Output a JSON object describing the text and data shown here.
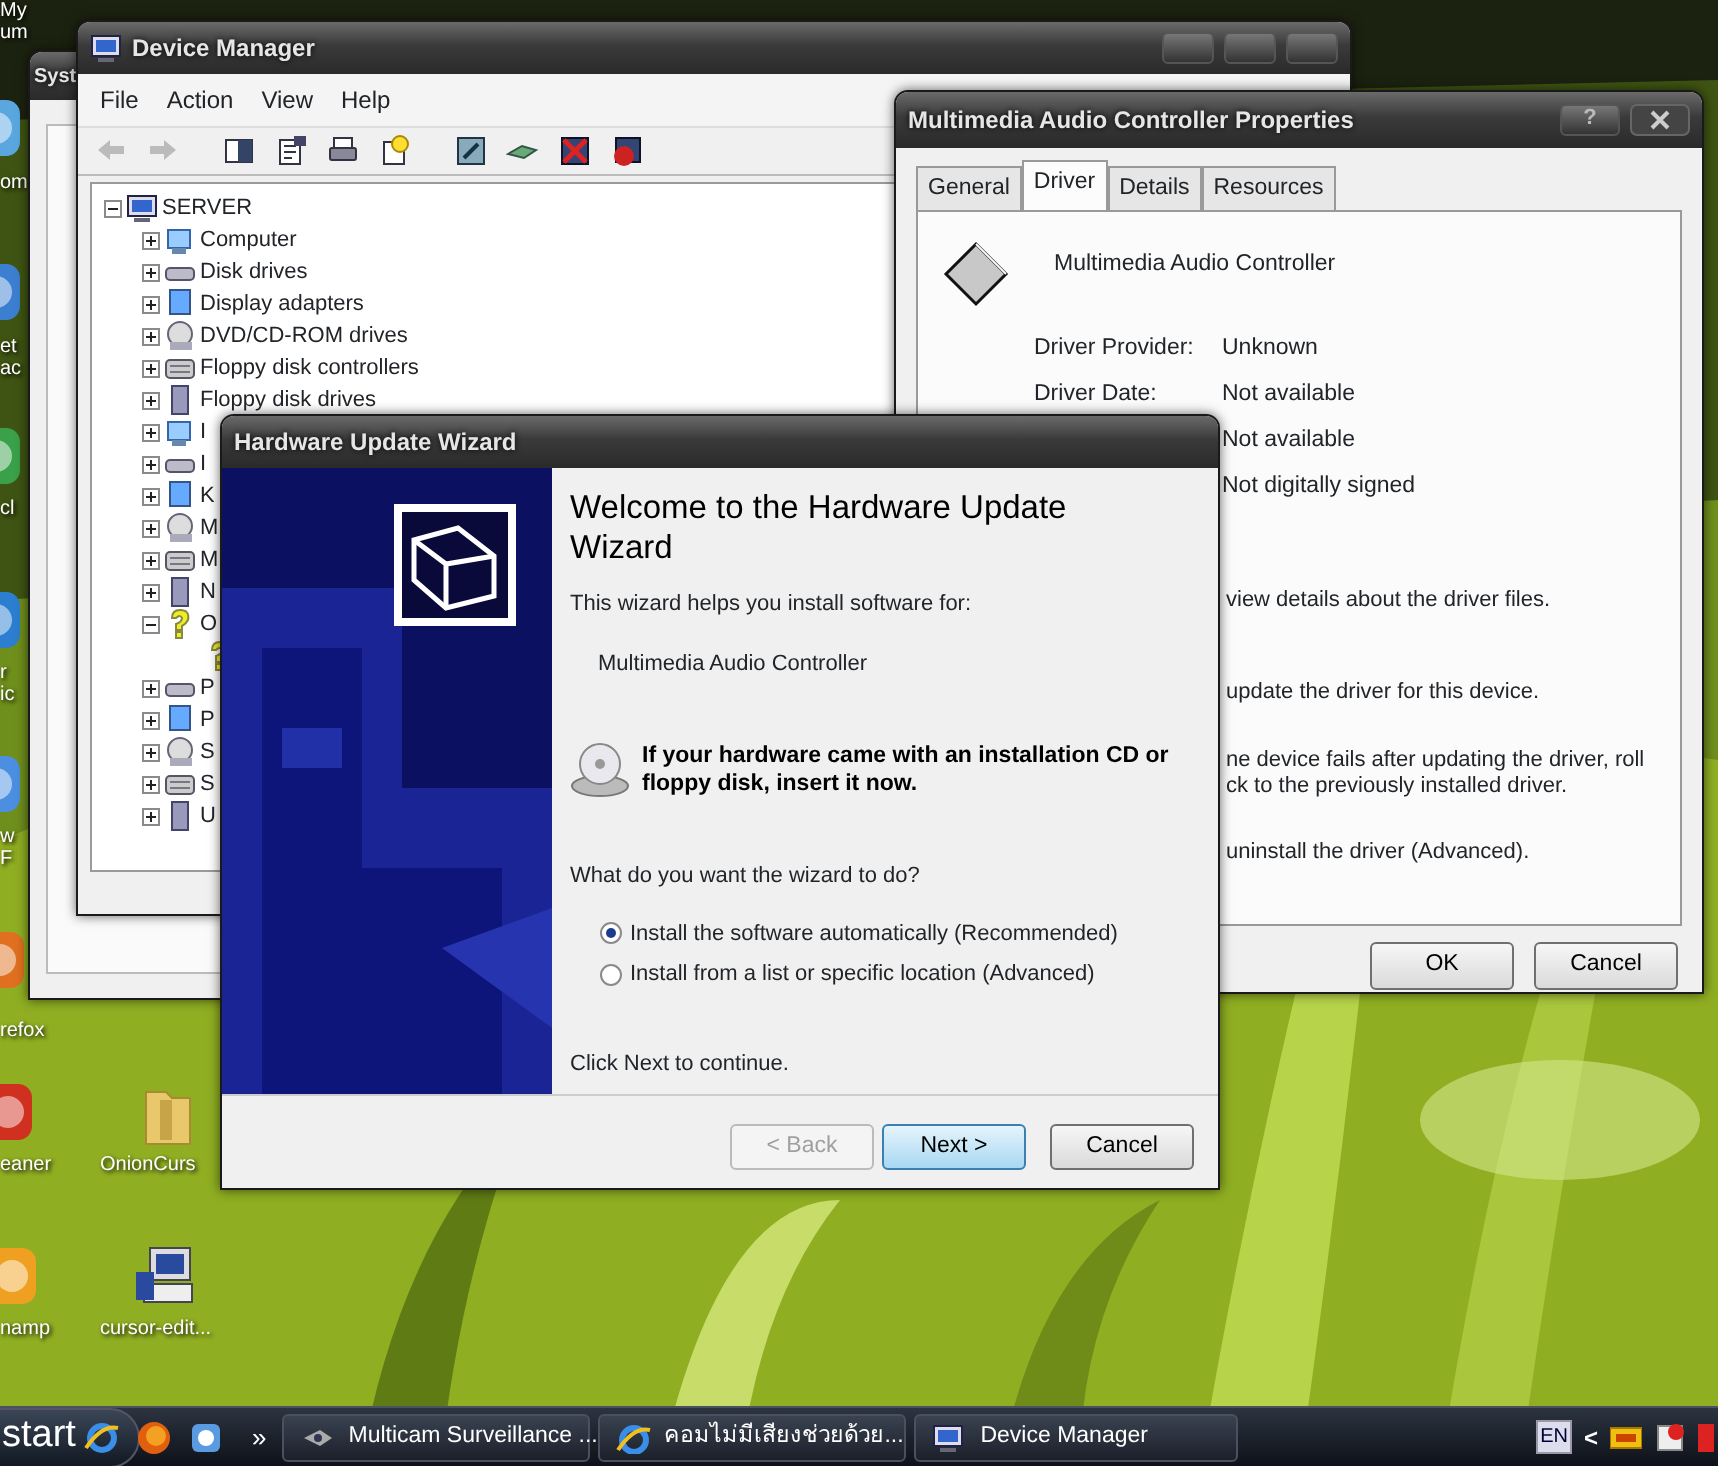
{
  "desktop_icons": [
    {
      "lines": [
        "My",
        "um"
      ]
    },
    {
      "lines": [
        "om"
      ]
    },
    {
      "lines": [
        "et",
        "ac"
      ]
    },
    {
      "lines": [
        "cl"
      ]
    },
    {
      "lines": [
        "r",
        "ic"
      ]
    },
    {
      "lines": [
        "w",
        "F"
      ]
    },
    {
      "lines": [
        "refox"
      ]
    },
    {
      "lines": [
        "eaner"
      ]
    },
    {
      "lines": [
        "namp"
      ]
    },
    {
      "lines": [
        "OnionCurs"
      ]
    },
    {
      "lines": [
        "cursor-edit..."
      ]
    }
  ],
  "system_window": {
    "title": "Syst"
  },
  "device_manager": {
    "title": "Device Manager",
    "menu": [
      "File",
      "Action",
      "View",
      "Help"
    ],
    "tree": [
      {
        "label": "SERVER",
        "kind": "root",
        "expanded": true,
        "children": [
          {
            "label": "Computer",
            "kind": "category",
            "expanded": false
          },
          {
            "label": "Disk drives",
            "kind": "category",
            "expanded": false
          },
          {
            "label": "Display adapters",
            "kind": "category",
            "expanded": false
          },
          {
            "label": "DVD/CD-ROM drives",
            "kind": "category",
            "expanded": false
          },
          {
            "label": "Floppy disk controllers",
            "kind": "category",
            "expanded": false
          },
          {
            "label": "Floppy disk drives",
            "kind": "category",
            "expanded": false
          },
          {
            "label": "I",
            "kind": "category",
            "expanded": false
          },
          {
            "label": "I",
            "kind": "category",
            "expanded": false
          },
          {
            "label": "K",
            "kind": "category",
            "expanded": false
          },
          {
            "label": "M",
            "kind": "category",
            "expanded": false
          },
          {
            "label": "M",
            "kind": "category",
            "expanded": false
          },
          {
            "label": "N",
            "kind": "category",
            "expanded": false
          },
          {
            "label": "O",
            "kind": "category",
            "expanded": true,
            "children": [
              {
                "kind": "leaf"
              }
            ]
          },
          {
            "label": "P",
            "kind": "category",
            "expanded": false
          },
          {
            "label": "P",
            "kind": "category",
            "expanded": false
          },
          {
            "label": "S",
            "kind": "category",
            "expanded": false
          },
          {
            "label": "S",
            "kind": "category",
            "expanded": false
          },
          {
            "label": "U",
            "kind": "category",
            "expanded": false
          }
        ]
      }
    ]
  },
  "properties": {
    "title": "Multimedia Audio Controller Properties",
    "help": "?",
    "tabs": [
      {
        "label": "General",
        "selected": false
      },
      {
        "label": "Driver",
        "selected": true
      },
      {
        "label": "Details",
        "selected": false
      },
      {
        "label": "Resources",
        "selected": false
      }
    ],
    "device_name": "Multimedia Audio Controller",
    "fields": [
      {
        "label": "Driver Provider:",
        "value": "Unknown"
      },
      {
        "label": "Driver Date:",
        "value": "Not available"
      },
      {
        "value": "Not available"
      },
      {
        "value": "Not digitally signed"
      }
    ],
    "descriptions": [
      [
        "view details about the driver files."
      ],
      [
        "update the driver for this device."
      ],
      [
        "ne device fails after updating the driver, roll",
        "ck to the previously installed driver."
      ],
      [
        "uninstall the driver (Advanced)."
      ]
    ],
    "buttons": [
      "OK",
      "Cancel"
    ]
  },
  "wizard": {
    "title": "Hardware Update Wizard",
    "heading": "Welcome to the Hardware Update Wizard",
    "intro": "This wizard helps you install software for:",
    "device": "Multimedia Audio Controller",
    "cd_note": "If your hardware came with an installation CD or floppy disk, insert it now.",
    "question": "What do you want the wizard to do?",
    "options": [
      {
        "label": "Install the software automatically (Recommended)",
        "selected": true
      },
      {
        "label": "Install from a list or specific location (Advanced)",
        "selected": false
      }
    ],
    "footer": "Click Next to continue.",
    "buttons": [
      {
        "label": "< Back",
        "disabled": true,
        "default": false
      },
      {
        "label": "Next >",
        "disabled": false,
        "default": true
      },
      {
        "label": "Cancel",
        "disabled": false,
        "default": false
      }
    ]
  },
  "taskbar": {
    "start": "start",
    "chevron": "»",
    "tasks": [
      {
        "label": "Multicam Surveillance ..."
      },
      {
        "label": "คอมไม่มีเสียงช่วยด้วย..."
      },
      {
        "label": "Device Manager"
      }
    ],
    "language": "EN",
    "tray_arrow": "<"
  }
}
